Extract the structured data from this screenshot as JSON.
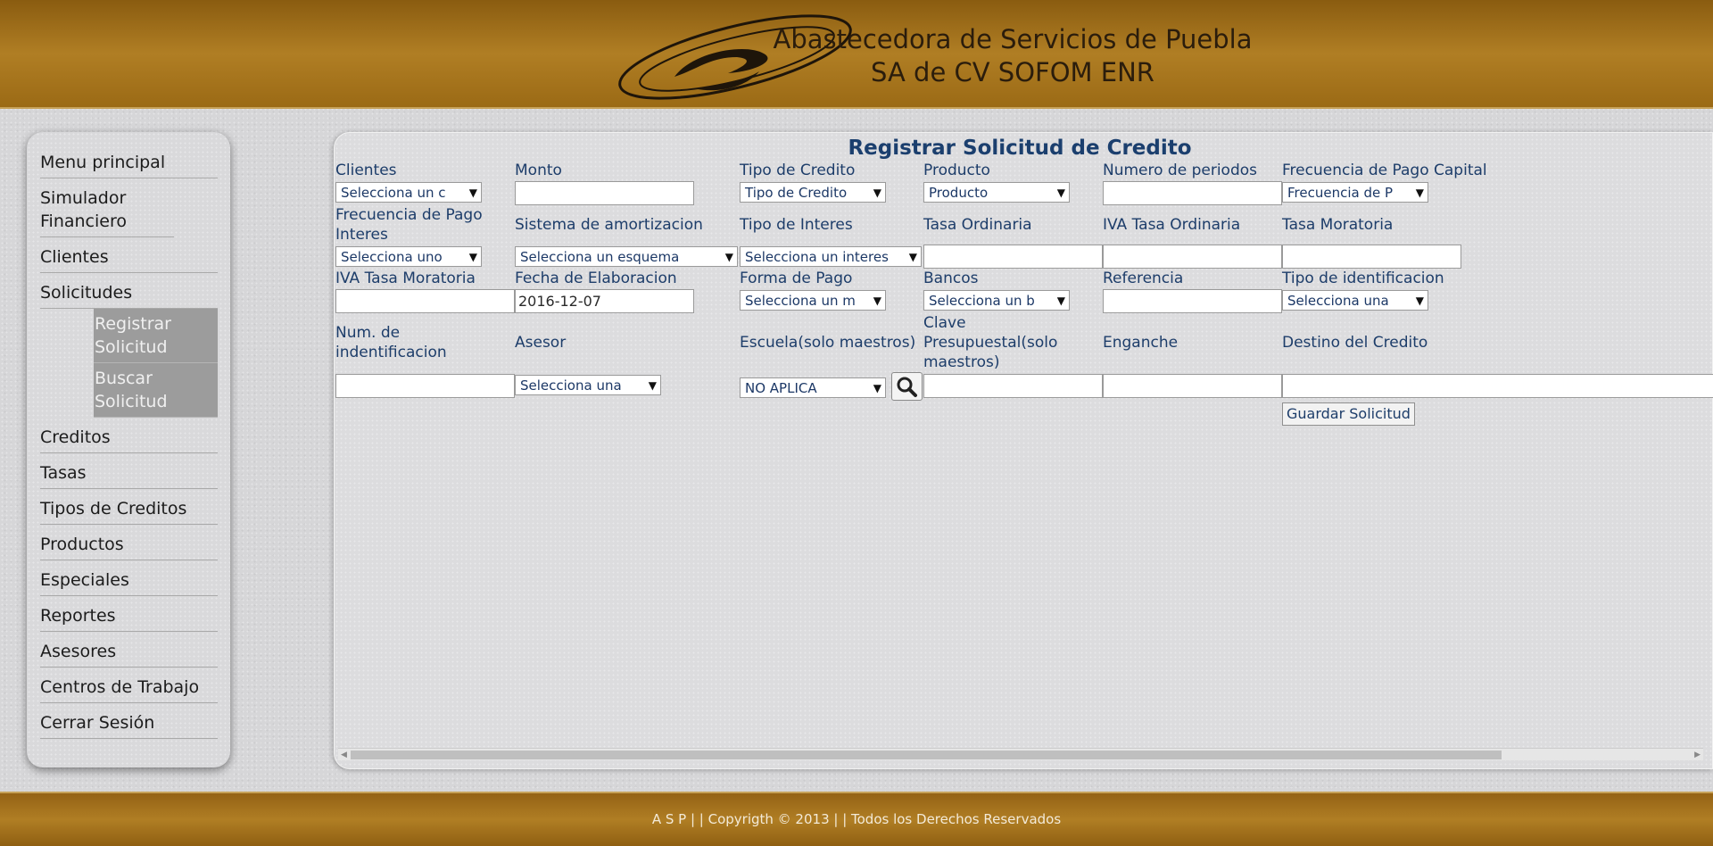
{
  "header": {
    "title_line1": "Abastecedora de Servicios de Puebla",
    "title_line2": "SA de CV SOFOM ENR"
  },
  "sidebar": {
    "items": [
      {
        "label": "Menu principal"
      },
      {
        "label": "Simulador Financiero"
      },
      {
        "label": "Clientes"
      },
      {
        "label": "Solicitudes"
      },
      {
        "label": "Creditos"
      },
      {
        "label": "Tasas"
      },
      {
        "label": "Tipos de Creditos"
      },
      {
        "label": "Productos"
      },
      {
        "label": "Especiales"
      },
      {
        "label": "Reportes"
      },
      {
        "label": "Asesores"
      },
      {
        "label": "Centros de Trabajo"
      },
      {
        "label": "Cerrar Sesión"
      }
    ],
    "sub_items": [
      {
        "label": "Registrar Solicitud"
      },
      {
        "label": "Buscar Solicitud"
      }
    ]
  },
  "form": {
    "title": "Registrar Solicitud de Credito",
    "labels": {
      "clientes": "Clientes",
      "monto": "Monto",
      "tipo_credito": "Tipo de Credito",
      "producto": "Producto",
      "numero_periodos": "Numero de periodos",
      "frecuencia_capital": "Frecuencia de Pago Capital",
      "frecuencia_interes": "Frecuencia de Pago Interes",
      "sistema_amortizacion": "Sistema de amortizacion",
      "tipo_interes": "Tipo de Interes",
      "tasa_ordinaria": "Tasa Ordinaria",
      "iva_tasa_ordinaria": "IVA Tasa Ordinaria",
      "tasa_moratoria": "Tasa Moratoria",
      "iva_tasa_moratoria": "IVA Tasa Moratoria",
      "fecha_elaboracion": "Fecha de Elaboracion",
      "forma_pago": "Forma de Pago",
      "bancos": "Bancos",
      "referencia": "Referencia",
      "tipo_identificacion": "Tipo de identificacion",
      "num_identificacion": "Num. de indentificacion",
      "asesor": "Asesor",
      "escuela": "Escuela(solo maestros)",
      "clave_presupuestal": "Clave Presupuestal(solo maestros)",
      "enganche": "Enganche",
      "destino_credito": "Destino del Credito"
    },
    "selects": {
      "clientes": "Selecciona un c",
      "tipo_credito": "Tipo de Credito",
      "producto": "Producto",
      "frecuencia_capital": "Frecuencia de P",
      "frecuencia_interes": "Selecciona uno",
      "sistema_amortizacion": "Selecciona un esquema",
      "tipo_interes": "Selecciona un interes",
      "forma_pago": "Selecciona un m",
      "bancos": "Selecciona un b",
      "tipo_identificacion": "Selecciona una",
      "asesor": "Selecciona una",
      "escuela": "NO APLICA"
    },
    "inputs": {
      "fecha_elaboracion": "2016-12-07"
    },
    "save_label": "Guardar Solicitud"
  },
  "footer": {
    "text": "A S P | | Copyrigth © 2013 | | Todos los Derechos Reservados"
  },
  "colors": {
    "header_gold": "#b07e24",
    "label_blue": "#1d3d6a",
    "title_blue": "#1b3f6e",
    "submenu_gray": "#9c9c9c"
  },
  "icons": {
    "logo": "swirl-logo-icon",
    "search": "search-icon",
    "dropdown": "chevron-down-icon"
  }
}
